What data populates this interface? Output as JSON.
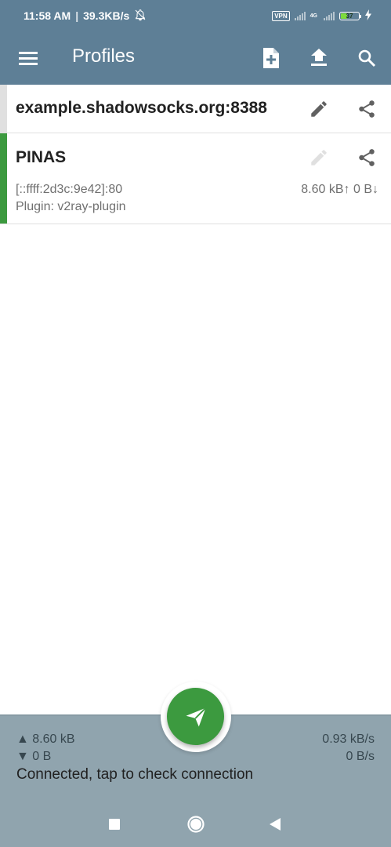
{
  "status_bar": {
    "time": "11:58 AM",
    "speed": "39.3KB/s",
    "vpn": "VPN",
    "network": "4G",
    "battery": "37",
    "icons": [
      "bell-off-icon",
      "signal-icon",
      "signal-4g-icon",
      "battery-icon",
      "charging-icon"
    ]
  },
  "toolbar": {
    "title": "Profiles",
    "actions": [
      "add-profile-icon",
      "import-icon",
      "search-icon"
    ]
  },
  "profiles": [
    {
      "name": "example.shadowsocks.org:8388",
      "selected": false,
      "bar_color": "#e0e0e0"
    },
    {
      "name": "PINAS",
      "address": "[::ffff:2d3c:9e42]:80",
      "plugin": "Plugin: v2ray-plugin",
      "traffic": "8.60 kB↑ 0 B↓",
      "selected": true,
      "bar_color": "#3c9a3f"
    }
  ],
  "stats": {
    "tx_total": "▲ 8.60 kB",
    "rx_total": "▼ 0 B",
    "tx_rate": "0.93 kB/s",
    "rx_rate": "0 B/s",
    "status": "Connected, tap to check connection"
  },
  "colors": {
    "primary": "#5e7f96",
    "accent": "#3c9a3f",
    "stats_bg": "#90a4ae"
  }
}
